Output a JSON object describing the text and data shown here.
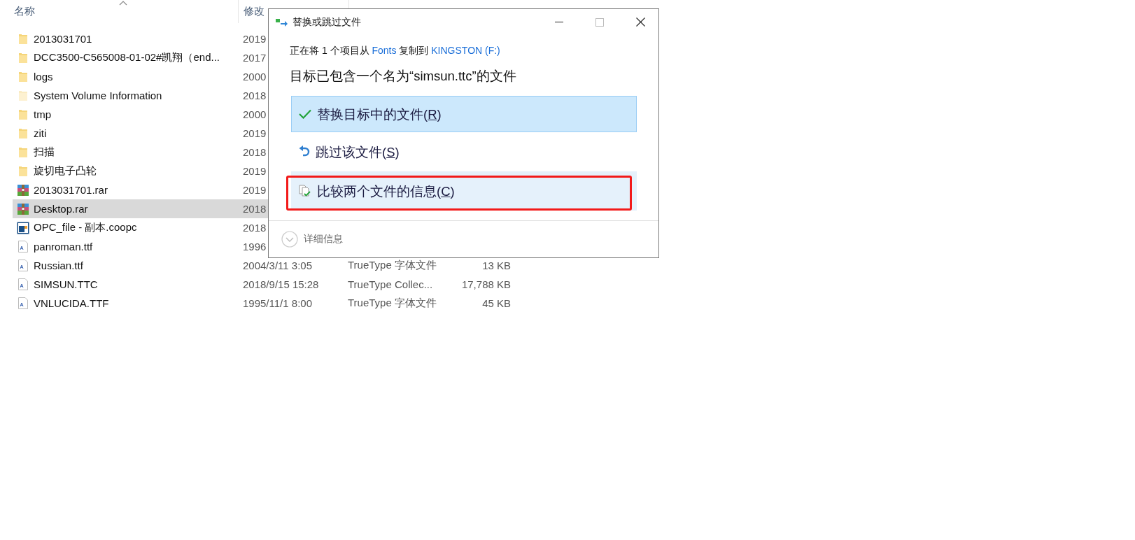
{
  "file_list": {
    "columns": [
      {
        "label": "名称",
        "sorted": true
      },
      {
        "label": "修改",
        "sorted": false
      }
    ],
    "rows": [
      {
        "kind": "folder",
        "name": "2013031701",
        "date": "2019",
        "selected": false
      },
      {
        "kind": "folder",
        "name": "DCC3500-C565008-01-02#凯翔（end...",
        "date": "2017",
        "selected": false
      },
      {
        "kind": "folder",
        "name": "logs",
        "date": "2000",
        "selected": false
      },
      {
        "kind": "hidden-folder",
        "name": "System Volume Information",
        "date": "2018",
        "selected": false
      },
      {
        "kind": "folder",
        "name": "tmp",
        "date": "2000",
        "selected": false
      },
      {
        "kind": "folder",
        "name": "ziti",
        "date": "2019",
        "selected": false
      },
      {
        "kind": "folder",
        "name": "扫描",
        "date": "2018",
        "selected": false
      },
      {
        "kind": "folder",
        "name": "旋切电子凸轮",
        "date": "2019",
        "selected": false
      },
      {
        "kind": "archive",
        "name": "2013031701.rar",
        "date": "2019",
        "selected": false
      },
      {
        "kind": "archive",
        "name": "Desktop.rar",
        "date": "2018",
        "selected": true
      },
      {
        "kind": "app",
        "name": "OPC_file - 副本.coopc",
        "date": "2018",
        "selected": false
      },
      {
        "kind": "font",
        "name": "panroman.ttf",
        "date": "1996",
        "selected": false
      },
      {
        "kind": "font",
        "name": "Russian.ttf",
        "date": "2004/3/11 3:05",
        "type": "TrueType 字体文件",
        "size": "13 KB",
        "selected": false
      },
      {
        "kind": "font",
        "name": "SIMSUN.TTC",
        "date": "2018/9/15 15:28",
        "type": "TrueType Collec...",
        "size": "17,788 KB",
        "selected": false
      },
      {
        "kind": "font",
        "name": "VNLUCIDA.TTF",
        "date": "1995/11/1 8:00",
        "type": "TrueType 字体文件",
        "size": "45 KB",
        "selected": false
      }
    ]
  },
  "dialog": {
    "title": "替换或跳过文件",
    "subtitle": {
      "before": "正在将 1 个项目从",
      "source": "Fonts",
      "middle": "复制到",
      "target": "KINGSTON (F:)"
    },
    "heading": "目标已包含一个名为“simsun.ttc”的文件",
    "options": [
      {
        "kind": "replace",
        "before": "替换目标中的文件(",
        "key": "R",
        "after": ")",
        "selected": true,
        "hovered": false,
        "annotated": false
      },
      {
        "kind": "skip",
        "before": "跳过该文件(",
        "key": "S",
        "after": ")",
        "selected": false,
        "hovered": false,
        "annotated": false
      },
      {
        "kind": "compare",
        "before": "比较两个文件的信息(",
        "key": "C",
        "after": ")",
        "selected": false,
        "hovered": true,
        "annotated": true
      }
    ],
    "details": {
      "label": "详细信息",
      "expanded": false
    }
  }
}
